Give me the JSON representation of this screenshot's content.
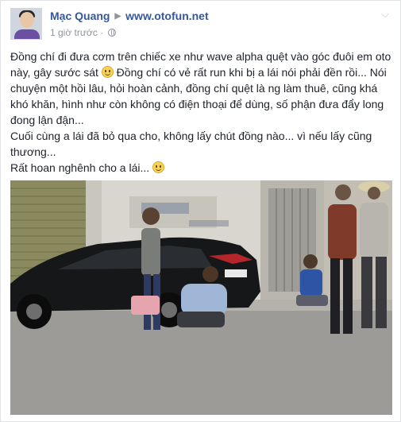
{
  "post": {
    "author": "Mạc Quang",
    "target": "www.otofun.net",
    "timestamp": "1 giờ trước",
    "privacy_icon": "globe-icon",
    "menu_icon": "chevron-down-icon",
    "paragraphs": [
      {
        "text": "Đồng chí đi đưa cơm trên chiếc xe như wave alpha quệt vào góc đuôi em oto này, gây sước sát ",
        "emoji": "smile"
      },
      {
        "text": " Đồng chí có vẻ rất run khi bị a lái nói phải đền rồi... Nói chuyện một hồi lâu, hỏi hoàn cảnh, đồng chí quệt là ng làm thuê, cũng khá khó khăn, hình như còn không có điện thoại để dùng, số phận đưa đẩy long đong lận đận...",
        "emoji": null
      },
      {
        "text": "Cuối cùng a lái đã bỏ qua cho, không lấy chút đồng nào... vì nếu lấy cũng thương...",
        "emoji": null
      },
      {
        "text": "Rất hoan nghênh cho a lái... ",
        "emoji": "smile"
      }
    ],
    "photo": {
      "subject": "street scene with black sedan, man crouching near rear bumper, onlookers"
    }
  },
  "colors": {
    "link": "#365899",
    "meta": "#90949c",
    "text": "#1d2129"
  }
}
